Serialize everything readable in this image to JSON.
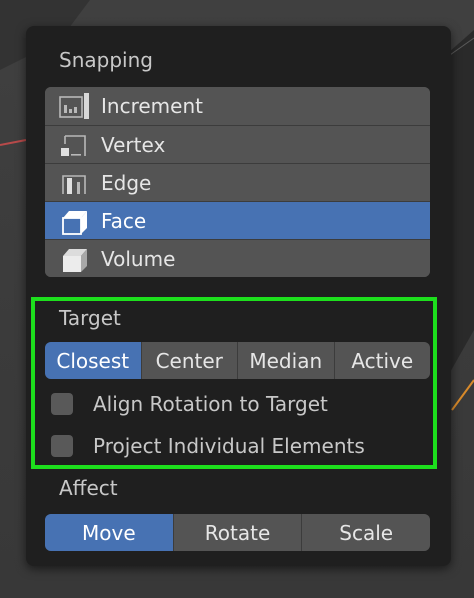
{
  "snapping": {
    "title": "Snapping",
    "items": [
      {
        "label": "Increment",
        "icon": "increment-snap-icon",
        "selected": false
      },
      {
        "label": "Vertex",
        "icon": "vertex-snap-icon",
        "selected": false
      },
      {
        "label": "Edge",
        "icon": "edge-snap-icon",
        "selected": false
      },
      {
        "label": "Face",
        "icon": "face-snap-icon",
        "selected": true
      },
      {
        "label": "Volume",
        "icon": "volume-snap-icon",
        "selected": false
      }
    ]
  },
  "target": {
    "title": "Target",
    "options": [
      "Closest",
      "Center",
      "Median",
      "Active"
    ],
    "selected": "Closest",
    "checkboxes": [
      {
        "label": "Align Rotation to Target",
        "checked": false
      },
      {
        "label": "Project Individual Elements",
        "checked": false
      }
    ]
  },
  "affect": {
    "title": "Affect",
    "options": [
      "Move",
      "Rotate",
      "Scale"
    ],
    "selected": "Move"
  },
  "colors": {
    "accent": "#4772b3",
    "highlight_outline": "#1ddf1d",
    "panel_bg": "#1f1f1f",
    "button_bg": "#545454"
  }
}
